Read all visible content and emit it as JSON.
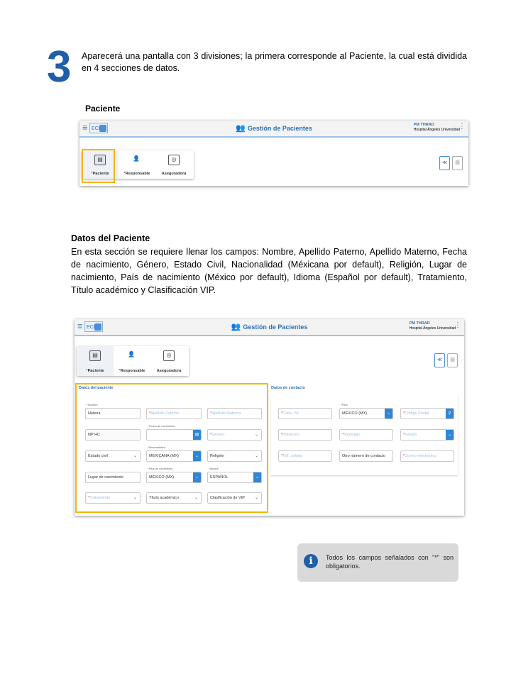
{
  "step": {
    "number": "3",
    "intro": "Aparecerá una pantalla con 3 divisiones; la primera corresponde al Paciente, la cual está dividida en 4 secciones de datos."
  },
  "section_label": "Paciente",
  "app": {
    "logo_text": "ECH",
    "title": "Gestión de Pacientes",
    "user_name": "PM THRAD",
    "user_hospital": "Hospital Ángeles Universidad",
    "tabs": [
      {
        "label": "Paciente",
        "required": "*"
      },
      {
        "label": "Responsable",
        "required": "*"
      },
      {
        "label": "Aseguradora",
        "required": ""
      }
    ]
  },
  "section2": {
    "heading": "Datos del Paciente",
    "paragraph": "En esta sección se requiere llenar los campos: Nombre, Apellido Paterno, Apellido Materno, Fecha de nacimiento, Género, Estado Civil, Nacionalidad (Méxicana por default), Religión, Lugar de nacimiento, País de nacimiento (México por default), Idioma (Español por default), Tratamiento, Título académico y Clasificación VIP."
  },
  "form": {
    "patient_title": "Datos del paciente",
    "contact_title": "Datos de contacto",
    "labels": {
      "nombre": "Nombre",
      "fecha": "Fecha de nacimiento",
      "nacionalidad": "Nacionalidad",
      "pais_nac": "País de nacimiento",
      "idioma": "Idioma",
      "pais": "País"
    },
    "values": {
      "nombre": "Helena",
      "apellido_paterno": "Apellido Paterno",
      "apellido_materno": "Apellido Materno",
      "np_hc": "NP HC",
      "genero": "Género",
      "estado_civil": "Estado civil",
      "nacionalidad": "MEXICANA (MX)",
      "religion": "Religión",
      "lugar_nac": "Lugar de nacimiento",
      "pais_nac": "MÉXICO (MX)",
      "idioma": "ESPAÑOL",
      "tratamiento": "Tratamiento",
      "titulo": "Título académico",
      "vip": "Clasificación de VIP",
      "calle": "Calle / Nº",
      "pais": "MÉXICO (MX)",
      "cp": "Código Postal",
      "poblacion": "Población",
      "municipio": "Municipio",
      "estado": "Estado",
      "celular": "Telf. celular",
      "otro": "Otro número de contacto",
      "correo": "Correo electrónico"
    }
  },
  "note": {
    "icon": "info-icon",
    "text": "Todos los campos señalados con \"*\" son obligatorios."
  },
  "colors": {
    "accent": "#1f5fa8",
    "highlight": "#f2b800",
    "required": "#e03a3a"
  }
}
